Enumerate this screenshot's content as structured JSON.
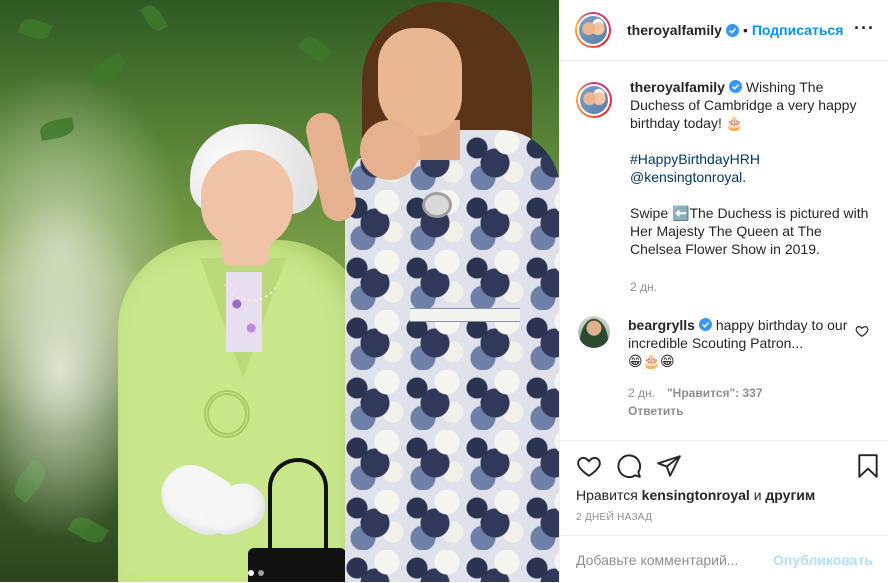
{
  "header": {
    "username": "theroyalfamily",
    "separator": "•",
    "follow_label": "Подписаться",
    "more_label": "···"
  },
  "caption": {
    "username": "theroyalfamily",
    "text_1": "Wishing The Duchess of Cambridge a very happy birthday today! 🎂",
    "hashtag": "#HappyBirthdayHRH",
    "mention": "@kensingtonroyal",
    "mention_suffix": ".",
    "text_2": "Swipe ⬅️The Duchess is pictured with Her Majesty The Queen at The Chelsea Flower Show in 2019.",
    "time": "2 дн."
  },
  "comment": {
    "username": "beargrylls",
    "text": "happy birthday to our incredible Scouting Patron...",
    "emoji": "😁🎂😁",
    "time": "2 дн.",
    "likes": "\"Нравится\": 337",
    "reply_label": "Ответить"
  },
  "actions": {
    "likes_prefix": "Нравится",
    "likes_user": "kensingtonroyal",
    "likes_joiner": "и",
    "likes_others": "другим",
    "date": "2 ДНЕЙ НАЗАД"
  },
  "add_comment": {
    "placeholder": "Добавьте комментарий...",
    "publish_label": "Опубликовать"
  },
  "colors": {
    "accent": "#0095f6",
    "link": "#00376b",
    "muted": "#8e8e8e",
    "publish_disabled": "#b2dffc"
  },
  "carousel": {
    "count": 2,
    "active": 1
  }
}
